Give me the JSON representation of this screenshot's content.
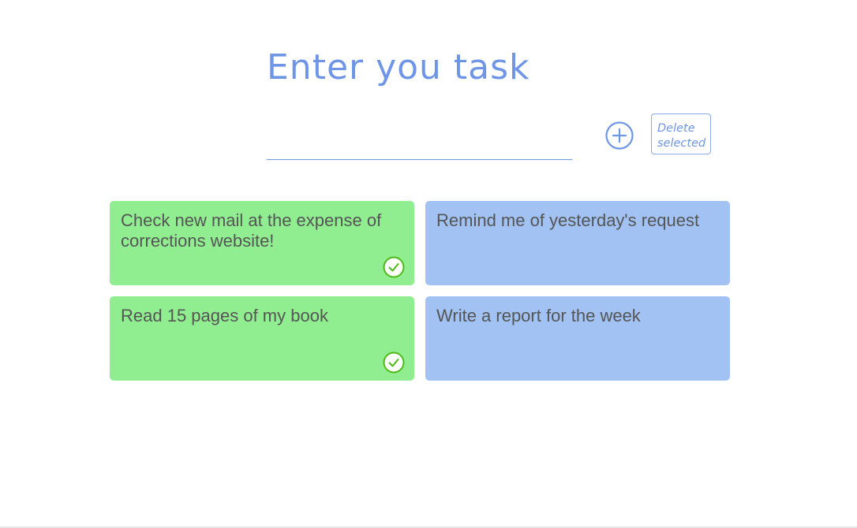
{
  "header": {
    "title": "Enter you task"
  },
  "form": {
    "input_value": "",
    "input_placeholder": "",
    "add_icon": "plus-circle-icon",
    "delete_label_line1": "Delete",
    "delete_label_line2": "selected"
  },
  "tasks": [
    {
      "text": "Check new mail at the expense of corrections website!",
      "status": "done",
      "icon": "check-circle-icon"
    },
    {
      "text": "Remind me of yesterday's request",
      "status": "pending"
    },
    {
      "text": "Read 15 pages of my book",
      "status": "done",
      "icon": "check-circle-icon"
    },
    {
      "text": "Write a report for the week",
      "status": "pending"
    }
  ],
  "colors": {
    "accent": "#6f95e6",
    "done_card": "#90ee90",
    "pending_card": "#a1c2f2",
    "text": "#555555",
    "check": "#4cbb17"
  }
}
